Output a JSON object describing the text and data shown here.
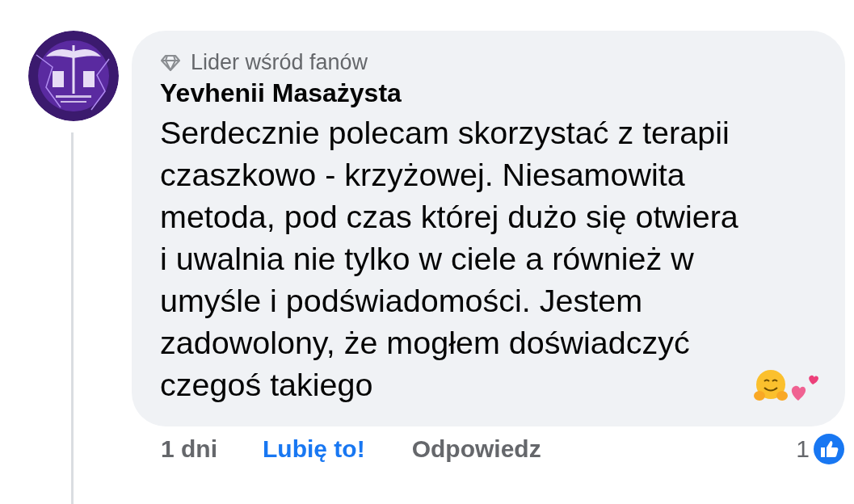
{
  "comment": {
    "badge": "Lider wśród fanów",
    "author": "Yevhenii Masażysta",
    "text": "Serdecznie polecam skorzystać z terapii czaszkowo - krzyżowej. Niesamowita metoda, pod czas której dużo się otwiera i uwalnia nie tylko w ciele a również w umyśle i podświadomości. Jestem zadowolony, że mogłem doświadczyć czegoś takiego",
    "time": "1 dni",
    "like_button": {
      "label": "Lubię to!",
      "liked": true
    },
    "reply_button": "Odpowiedz",
    "reaction_count": "1"
  }
}
